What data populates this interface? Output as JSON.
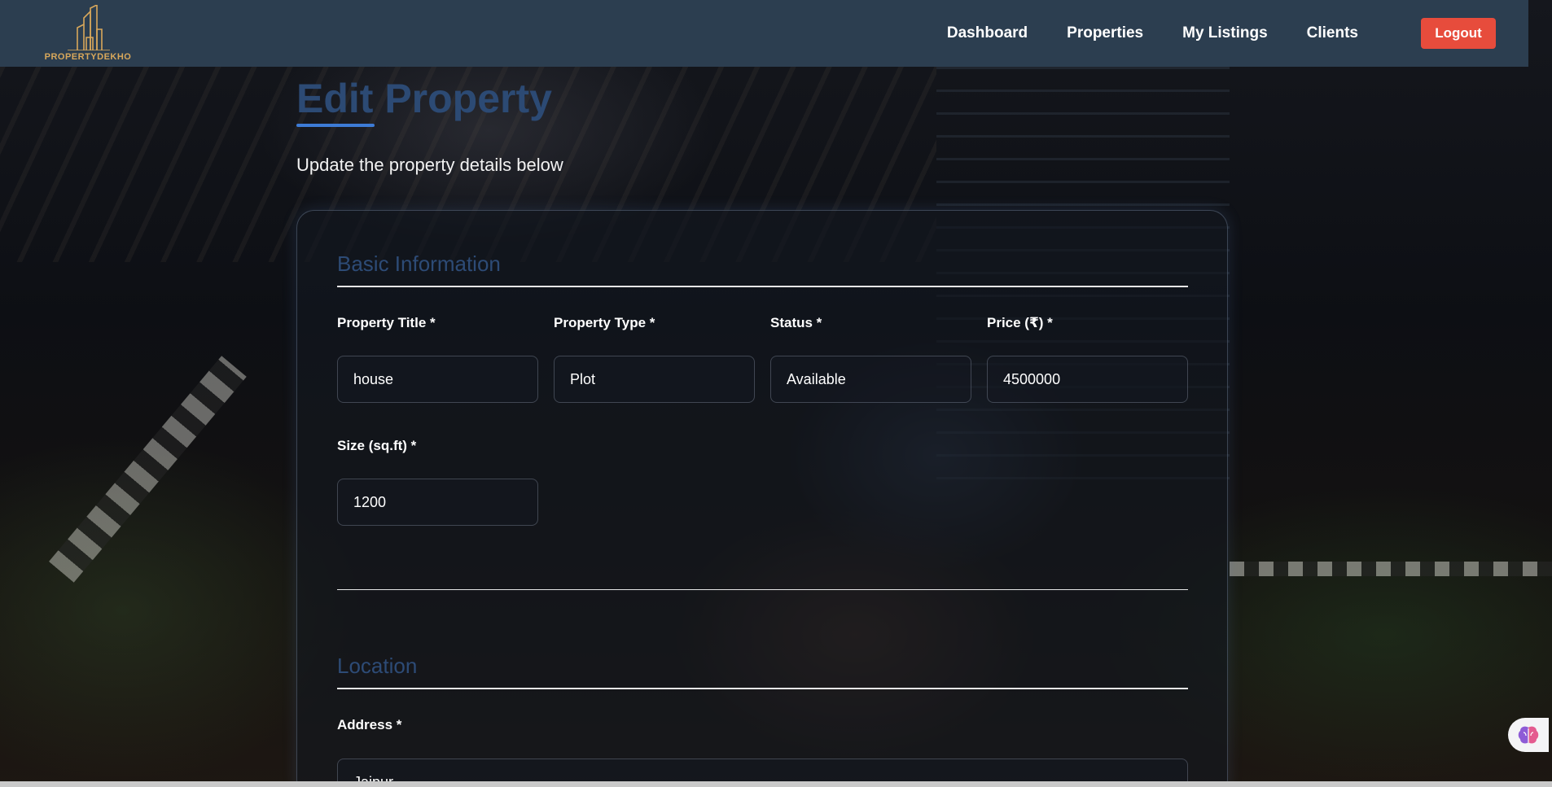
{
  "brand": {
    "name": "PROPERTYDEKHO",
    "logo_icon": "buildings-logo-icon",
    "logo_color": "#d9a85b"
  },
  "nav": {
    "items": [
      {
        "label": "Dashboard"
      },
      {
        "label": "Properties"
      },
      {
        "label": "My Listings"
      },
      {
        "label": "Clients"
      }
    ],
    "logout_label": "Logout",
    "bar_color": "#2c3e50",
    "logout_color": "#e74c3c"
  },
  "page": {
    "title": "Edit Property",
    "subtitle": "Update the property details below",
    "title_color": "#2c4a74",
    "accent_color": "#3d7bd6"
  },
  "sections": {
    "basic": {
      "title": "Basic Information",
      "fields": {
        "title": {
          "label": "Property Title *",
          "value": "house"
        },
        "type": {
          "label": "Property Type *",
          "value": "Plot"
        },
        "status": {
          "label": "Status *",
          "value": "Available"
        },
        "price": {
          "label": "Price (₹) *",
          "value": "4500000"
        },
        "size": {
          "label": "Size (sq.ft) *",
          "value": "1200"
        }
      }
    },
    "location": {
      "title": "Location",
      "fields": {
        "address": {
          "label": "Address *",
          "value": "Jaipur"
        }
      }
    }
  },
  "widget": {
    "icon": "brain-icon"
  }
}
